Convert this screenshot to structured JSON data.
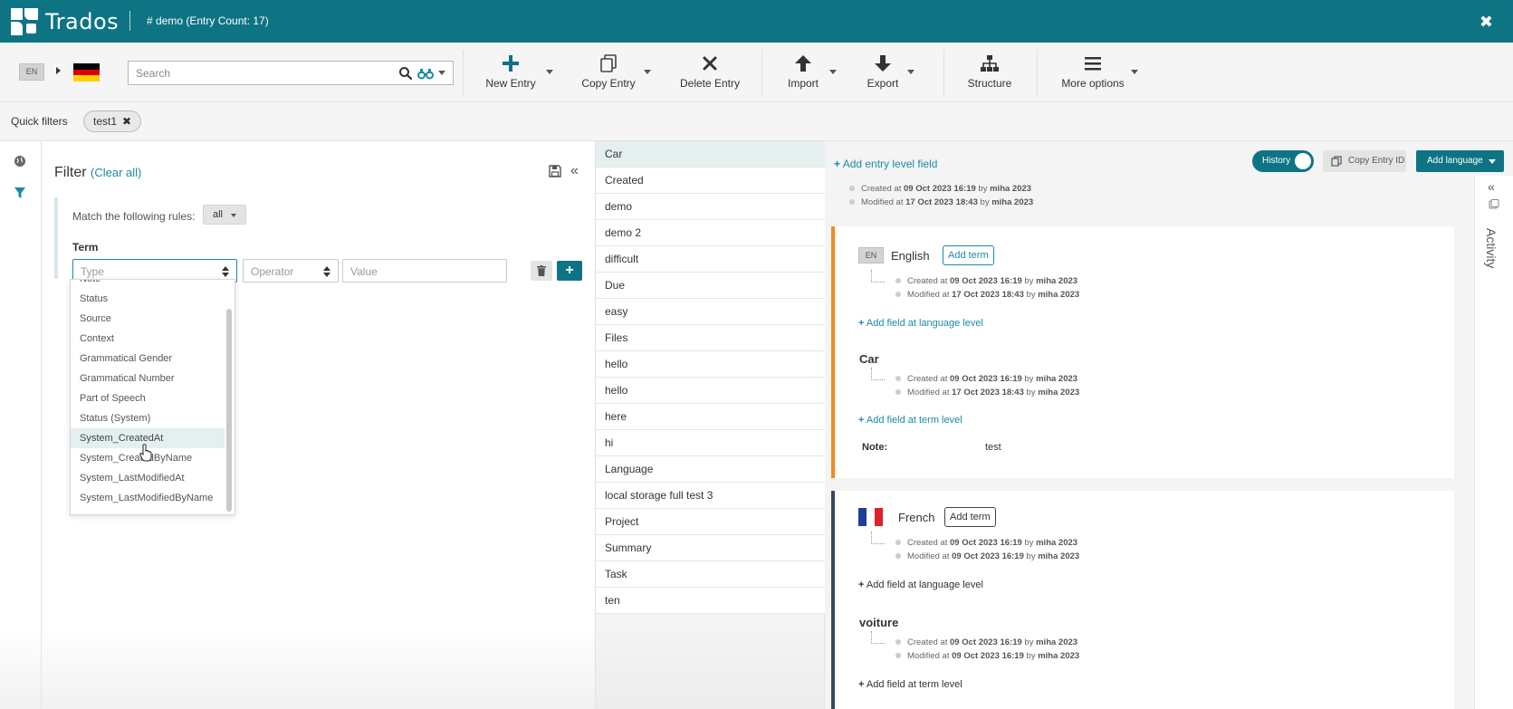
{
  "header": {
    "app_name": "Trados",
    "title": "# demo (Entry Count: 17)",
    "close_glyph": "✖"
  },
  "toolbar": {
    "source_lang": "EN",
    "target_flag": "germany-flag",
    "search_placeholder": "Search",
    "buttons": {
      "new_entry": "New Entry",
      "copy_entry": "Copy Entry",
      "delete_entry": "Delete Entry",
      "import": "Import",
      "export": "Export",
      "structure": "Structure",
      "more_options": "More options"
    }
  },
  "quick_filters": {
    "label": "Quick filters",
    "chips": [
      "test1"
    ],
    "chip_remove": "✖"
  },
  "filter": {
    "title": "Filter",
    "clear_all": "(Clear all)",
    "match_text": "Match the following rules:",
    "match_value": "all",
    "term_label": "Term",
    "type_placeholder": "Type",
    "operator_placeholder": "Operator",
    "value_placeholder": "Value",
    "add_glyph": "+",
    "collapse_glyph": "«",
    "type_options": [
      "Note",
      "Status",
      "Source",
      "Context",
      "Grammatical Gender",
      "Grammatical Number",
      "Part of Speech",
      "Status (System)",
      "System_CreatedAt",
      "System_CreatedByName",
      "System_LastModifiedAt",
      "System_LastModifiedByName"
    ],
    "highlighted_option": "System_CreatedAt"
  },
  "entries": [
    "Car",
    "Created",
    "demo",
    "demo 2",
    "difficult",
    "Due",
    "easy",
    "Files",
    "hello",
    "hello",
    "here",
    "hi",
    "Language",
    "local storage full test 3",
    "Project",
    "Summary",
    "Task",
    "ten"
  ],
  "detail": {
    "add_entry_field": "Add entry level field",
    "history_label": "History",
    "copy_entry_id": "Copy Entry ID",
    "add_language": "Add language",
    "activity_label": "Activity",
    "collapse_glyph": "«",
    "entry_meta": {
      "created_prefix": "Created at",
      "created_at": "09 Oct 2023 16:19",
      "modified_prefix": "Modified at",
      "modified_at": "17 Oct 2023 18:43",
      "by": "by",
      "user": "miha 2023"
    },
    "languages": [
      {
        "code": "EN",
        "name": "English",
        "add_term": "Add term",
        "created_at": "09 Oct 2023 16:19",
        "modified_at": "17 Oct 2023 18:43",
        "add_lang_field": "Add field at language level",
        "term": "Car",
        "term_created_at": "09 Oct 2023 16:19",
        "term_modified_at": "17 Oct 2023 18:43",
        "add_term_field": "Add field at term level",
        "note_label": "Note:",
        "note_value": "test"
      },
      {
        "code": "FR",
        "name": "French",
        "add_term": "Add term",
        "created_at": "09 Oct 2023 16:19",
        "modified_at": "09 Oct 2023 16:19",
        "add_lang_field": "Add field at language level",
        "term": "voiture",
        "term_created_at": "09 Oct 2023 16:19",
        "term_modified_at": "09 Oct 2023 16:19",
        "add_term_field": "Add field at term level"
      }
    ]
  },
  "colors": {
    "brand_teal": "#0e7484",
    "link_teal": "#1a8aa6",
    "english_accent": "#f08c1e",
    "french_accent": "#3a4660"
  }
}
